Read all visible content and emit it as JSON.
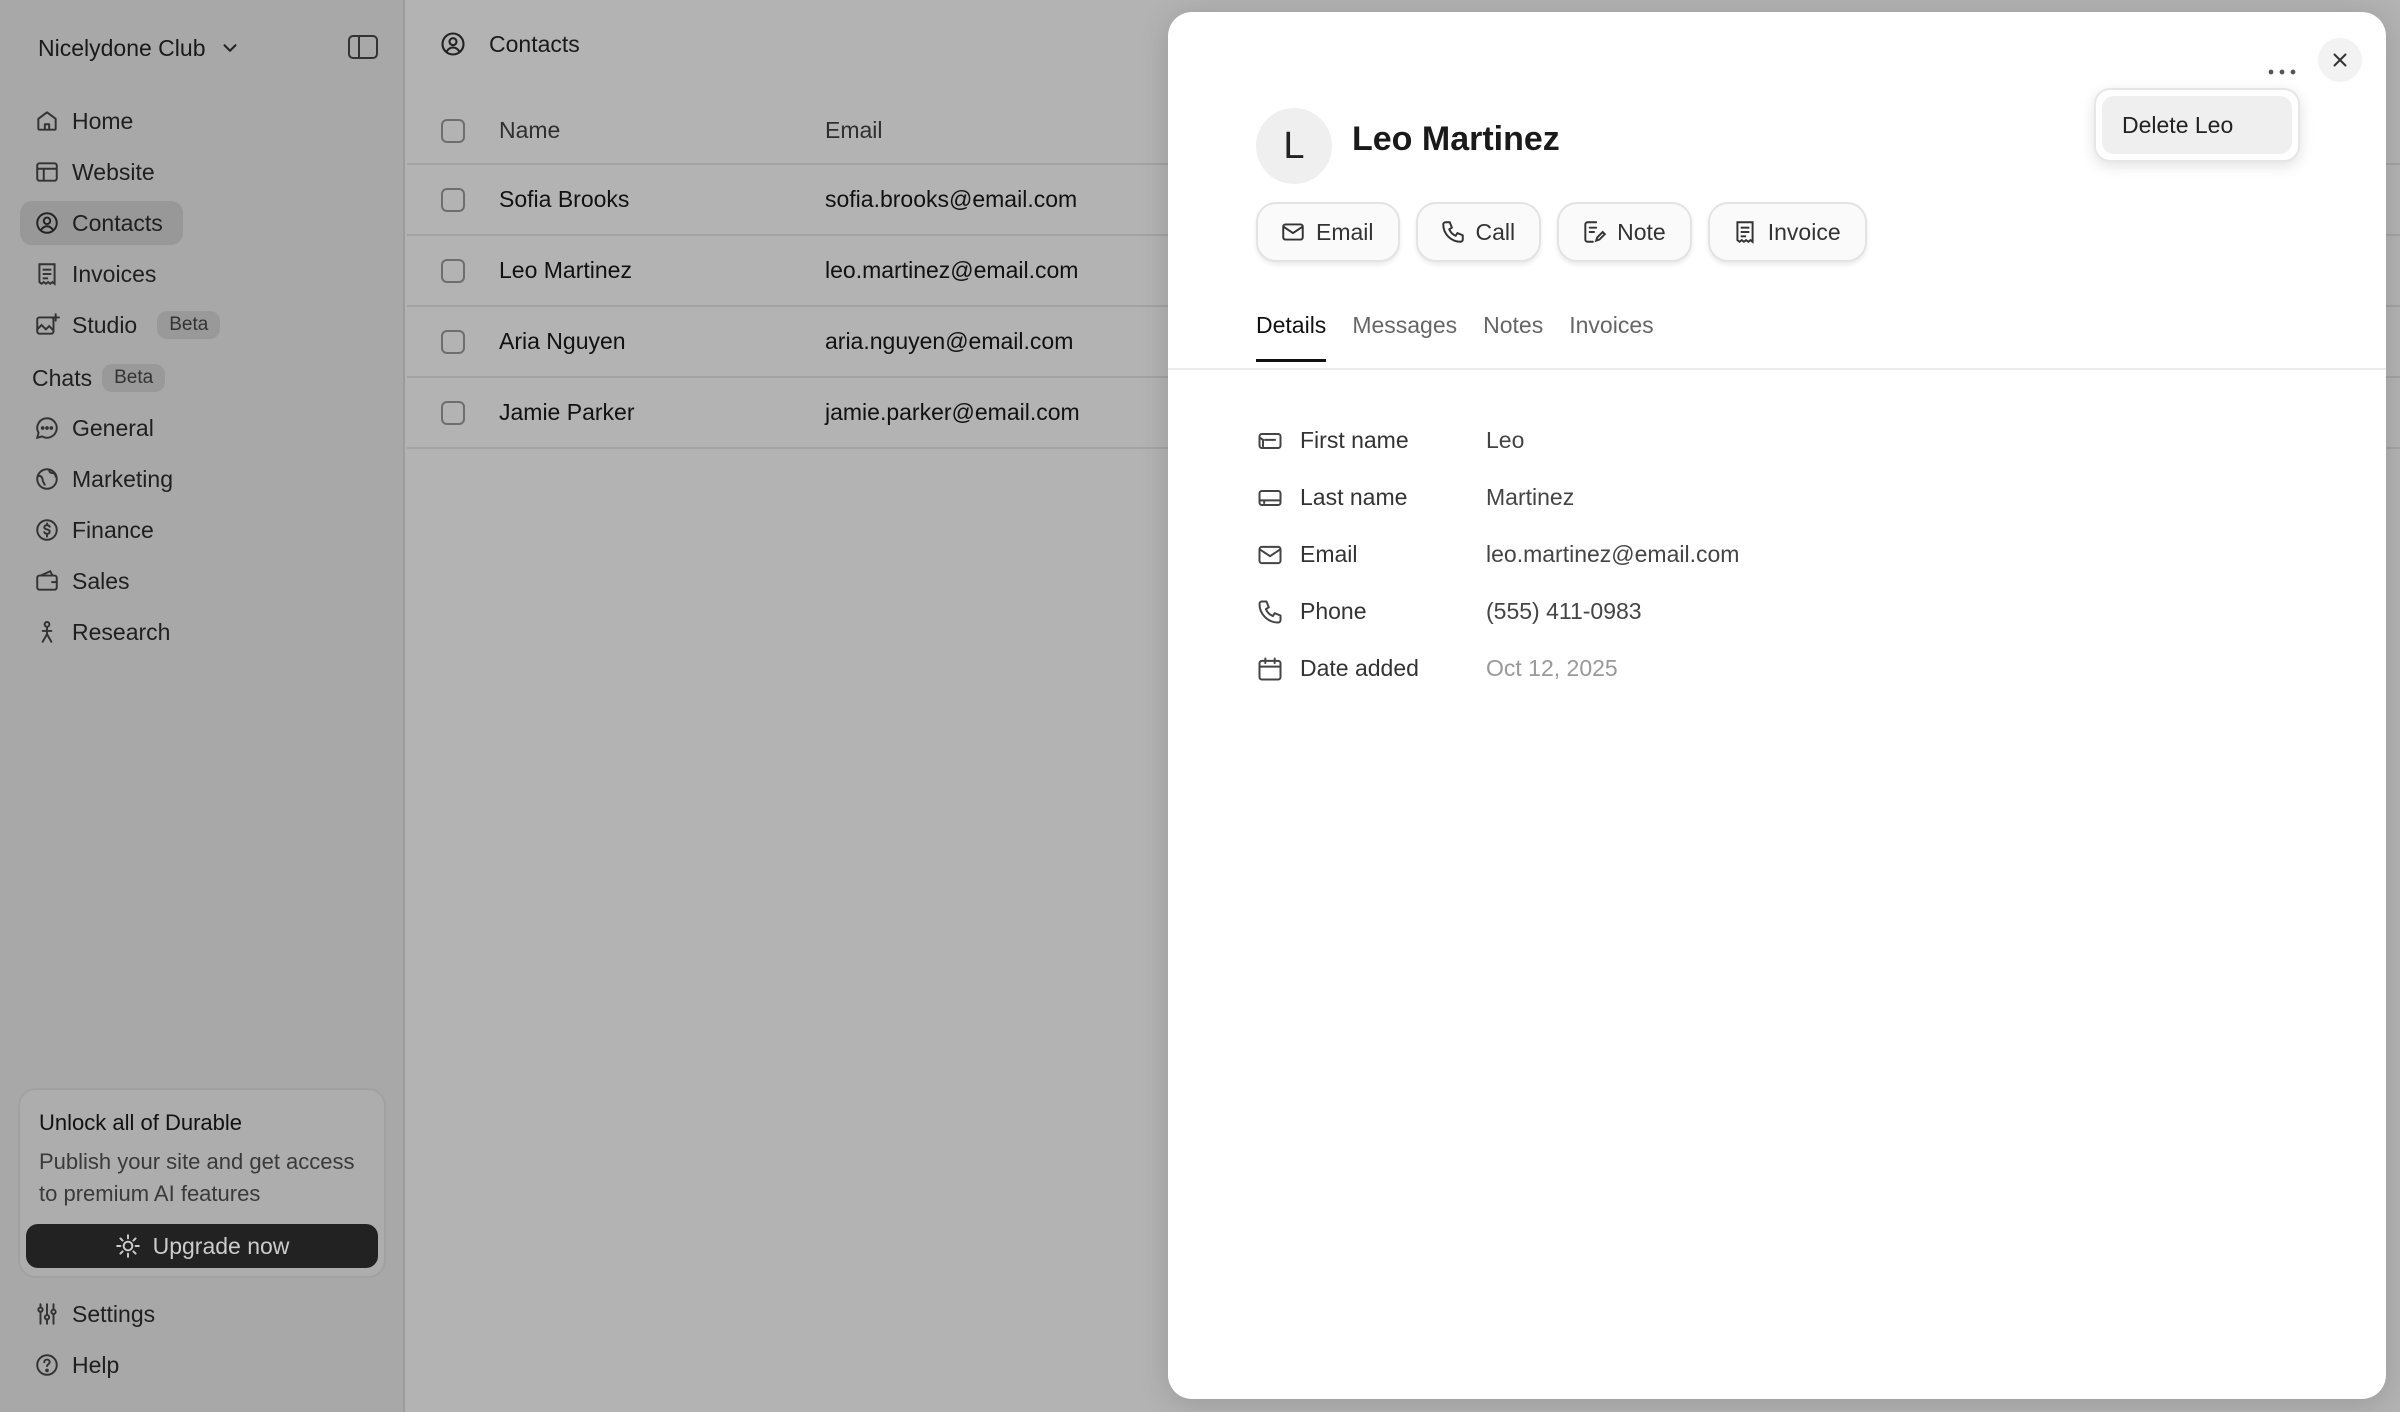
{
  "sidebar": {
    "org_name": "Nicelydone Club",
    "nav": [
      {
        "label": "Home",
        "icon": "home-icon"
      },
      {
        "label": "Website",
        "icon": "website-icon"
      },
      {
        "label": "Contacts",
        "icon": "contacts-icon",
        "active": true
      },
      {
        "label": "Invoices",
        "icon": "invoice-icon"
      },
      {
        "label": "Studio",
        "icon": "studio-icon",
        "badge": "Beta"
      }
    ],
    "chats_header": "Chats",
    "chats_badge": "Beta",
    "chats": [
      {
        "label": "General",
        "icon": "chat-bubble-icon"
      },
      {
        "label": "Marketing",
        "icon": "globe-icon"
      },
      {
        "label": "Finance",
        "icon": "dollar-icon"
      },
      {
        "label": "Sales",
        "icon": "wallet-icon"
      },
      {
        "label": "Research",
        "icon": "person-icon"
      }
    ],
    "upgrade": {
      "title": "Unlock all of Durable",
      "text": "Publish your site and get access to premium AI features",
      "button": "Upgrade now"
    },
    "footer": [
      {
        "label": "Settings",
        "icon": "settings-icon"
      },
      {
        "label": "Help",
        "icon": "help-icon"
      }
    ]
  },
  "main": {
    "title": "Contacts",
    "columns": {
      "name": "Name",
      "email": "Email"
    },
    "rows": [
      {
        "name": "Sofia Brooks",
        "email": "sofia.brooks@email.com"
      },
      {
        "name": "Leo Martinez",
        "email": "leo.martinez@email.com"
      },
      {
        "name": "Aria Nguyen",
        "email": "aria.nguyen@email.com"
      },
      {
        "name": "Jamie Parker",
        "email": "jamie.parker@email.com"
      }
    ]
  },
  "drawer": {
    "avatar_initial": "L",
    "name": "Leo Martinez",
    "actions": [
      "Email",
      "Call",
      "Note",
      "Invoice"
    ],
    "tabs": [
      "Details",
      "Messages",
      "Notes",
      "Invoices"
    ],
    "active_tab": "Details",
    "details": [
      {
        "label": "First name",
        "value": "Leo"
      },
      {
        "label": "Last name",
        "value": "Martinez"
      },
      {
        "label": "Email",
        "value": "leo.martinez@email.com"
      },
      {
        "label": "Phone",
        "value": "(555) 411-0983"
      },
      {
        "label": "Date added",
        "value": "Oct 12, 2025"
      }
    ],
    "menu_item": "Delete Leo"
  },
  "colors": {
    "accent": "#222222",
    "overlay": "#b3b3b3",
    "panel": "#ffffff"
  }
}
